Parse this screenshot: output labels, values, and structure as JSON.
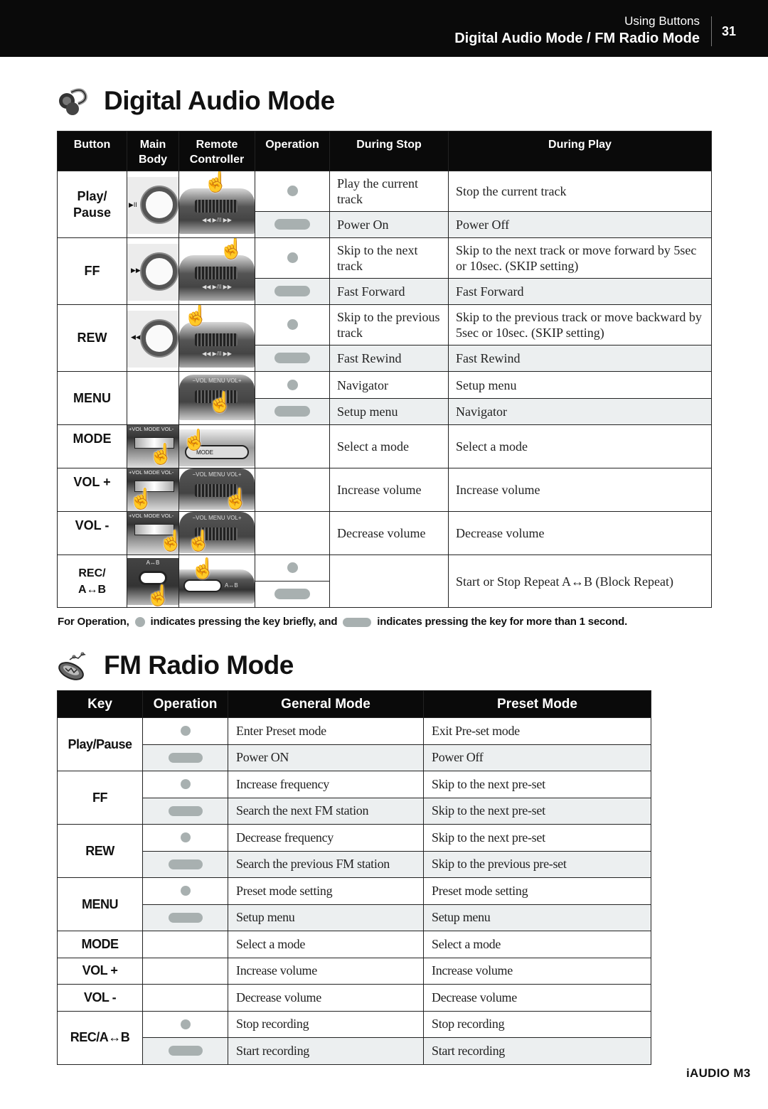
{
  "header": {
    "section": "Using Buttons",
    "title": "Digital Audio Mode / FM Radio Mode",
    "page_number": "31"
  },
  "digital_audio": {
    "title": "Digital Audio Mode",
    "icon": "headphones-icon",
    "columns": [
      "Button",
      "Main Body",
      "Remote Controller",
      "Operation",
      "During Stop",
      "During Play"
    ],
    "rows": [
      {
        "button": "Play/ Pause",
        "main_body_symbol": "▶II",
        "remote_labels": "◀◀  ▶/II  ▶▶",
        "ops": [
          {
            "press": "short",
            "during_stop": "Play the current track",
            "during_play": "Stop the current track"
          },
          {
            "press": "long",
            "during_stop": "Power On",
            "during_play": "Power Off"
          }
        ]
      },
      {
        "button": "FF",
        "main_body_symbol": "▶▶",
        "remote_labels": "◀◀  ▶/II  ▶▶",
        "ops": [
          {
            "press": "short",
            "during_stop": "Skip to the next track",
            "during_play": "Skip to the next track or move forward by 5sec or 10sec. (SKIP setting)"
          },
          {
            "press": "long",
            "during_stop": "Fast Forward",
            "during_play": "Fast Forward"
          }
        ]
      },
      {
        "button": "REW",
        "main_body_symbol": "◀◀",
        "remote_labels": "◀◀  ▶/II  ▶▶",
        "ops": [
          {
            "press": "short",
            "during_stop": "Skip to the previous track",
            "during_play": "Skip to the previous track or move backward by 5sec or 10sec. (SKIP setting)"
          },
          {
            "press": "long",
            "during_stop": "Fast Rewind",
            "during_play": "Fast Rewind"
          }
        ]
      },
      {
        "button": "MENU",
        "remote_labels": "−VOL  MENU  VOL+",
        "ops": [
          {
            "press": "short",
            "during_stop": "Navigator",
            "during_play": "Setup menu"
          },
          {
            "press": "long",
            "during_stop": "Setup menu",
            "during_play": "Navigator"
          }
        ]
      },
      {
        "button": "MODE",
        "main_body_labels": "+VOL MODE VOL-",
        "remote_labels": "MODE",
        "ops": [
          {
            "press": "none",
            "during_stop": "Select a mode",
            "during_play": "Select a mode"
          }
        ]
      },
      {
        "button": "VOL +",
        "main_body_labels": "+VOL MODE VOL-",
        "remote_labels": "−VOL  MENU  VOL+",
        "ops": [
          {
            "press": "none",
            "during_stop": "Increase volume",
            "during_play": "Increase volume"
          }
        ]
      },
      {
        "button": "VOL -",
        "main_body_labels": "+VOL MODE VOL-",
        "remote_labels": "−VOL  MENU  VOL+",
        "ops": [
          {
            "press": "none",
            "during_stop": "Decrease volume",
            "during_play": "Decrease volume"
          }
        ]
      },
      {
        "button": "REC/ A↔B",
        "main_body_labels": "A↔B",
        "remote_labels": "A↔B",
        "ops": [
          {
            "press": "short",
            "during_stop": "",
            "during_play": "Start or Stop Repeat A↔B (Block Repeat)"
          },
          {
            "press": "long"
          }
        ]
      }
    ],
    "footnote": {
      "prefix": "For Operation,",
      "short_text": "indicates pressing the key briefly, and",
      "long_text": "indicates pressing the key for more than 1 second."
    }
  },
  "fm_radio": {
    "title": "FM Radio Mode",
    "icon": "radio-icon",
    "columns": [
      "Key",
      "Operation",
      "General Mode",
      "Preset Mode"
    ],
    "rows": [
      {
        "key": "Play/Pause",
        "ops": [
          {
            "press": "short",
            "general": "Enter Preset mode",
            "preset": "Exit Pre-set mode"
          },
          {
            "press": "long",
            "general": "Power ON",
            "preset": "Power Off"
          }
        ]
      },
      {
        "key": "FF",
        "ops": [
          {
            "press": "short",
            "general": "Increase frequency",
            "preset": "Skip to the next pre-set"
          },
          {
            "press": "long",
            "general": "Search the next FM station",
            "preset": "Skip to the next pre-set"
          }
        ]
      },
      {
        "key": "REW",
        "ops": [
          {
            "press": "short",
            "general": "Decrease frequency",
            "preset": "Skip to the next pre-set"
          },
          {
            "press": "long",
            "general": "Search the previous FM station",
            "preset": "Skip to the previous pre-set"
          }
        ]
      },
      {
        "key": "MENU",
        "ops": [
          {
            "press": "short",
            "general": "Preset mode setting",
            "preset": "Preset mode setting"
          },
          {
            "press": "long",
            "general": "Setup menu",
            "preset": "Setup menu"
          }
        ]
      },
      {
        "key": "MODE",
        "ops": [
          {
            "press": "none",
            "general": "Select a mode",
            "preset": "Select a mode"
          }
        ]
      },
      {
        "key": "VOL +",
        "ops": [
          {
            "press": "none",
            "general": "Increase volume",
            "preset": "Increase volume"
          }
        ]
      },
      {
        "key": "VOL -",
        "ops": [
          {
            "press": "none",
            "general": "Decrease volume",
            "preset": "Decrease volume"
          }
        ]
      },
      {
        "key": "REC/A↔B",
        "ops": [
          {
            "press": "short",
            "general": "Stop recording",
            "preset": "Stop recording"
          },
          {
            "press": "long",
            "general": "Start recording",
            "preset": "Start recording"
          }
        ]
      }
    ]
  },
  "footer": {
    "brand": "iAUDIO M3"
  },
  "colors": {
    "header_bg": "#0a0a0a",
    "long_press_row": "#eceff0",
    "press_indicator": "#a8b0b0"
  }
}
